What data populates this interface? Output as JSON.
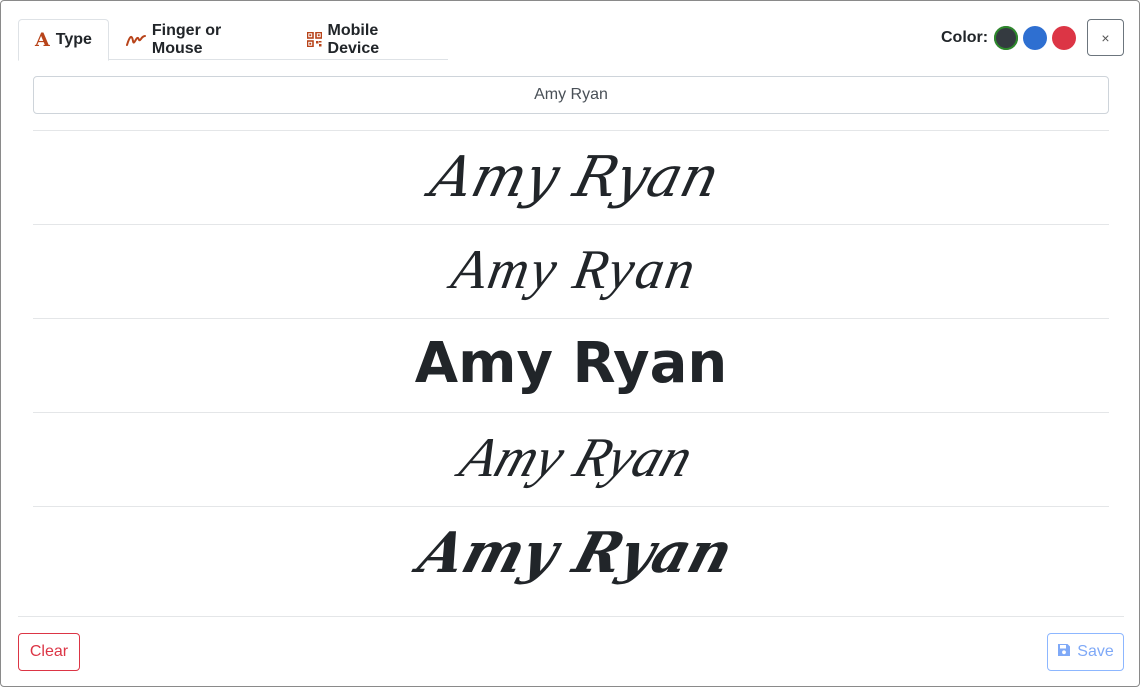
{
  "tabs": [
    {
      "label": "Type",
      "icon": "letter-a-icon",
      "active": true
    },
    {
      "label": "Finger or Mouse",
      "icon": "pen-squiggle-icon",
      "active": false
    },
    {
      "label": "Mobile Device",
      "icon": "qr-code-icon",
      "active": false
    }
  ],
  "colors": {
    "label": "Color:",
    "options": [
      "#343a40",
      "#2e6fd1",
      "#dc3545"
    ],
    "selected": "#343a40",
    "selected_ring": "#2d8a2b"
  },
  "close": {
    "label": "×"
  },
  "name_input": {
    "value": "Amy Ryan"
  },
  "signatures": [
    {
      "text": "Amy Ryan",
      "style": "script-light"
    },
    {
      "text": "Amy Ryan",
      "style": "script-handwritten"
    },
    {
      "text": "Amy Ryan",
      "style": "bold-rounded"
    },
    {
      "text": "Amy Ryan",
      "style": "script-flourish"
    },
    {
      "text": "Amy Ryan",
      "style": "brush-bold"
    }
  ],
  "footer": {
    "clear_label": "Clear",
    "save_label": "Save"
  },
  "accent": {
    "tab_icon": "#b8441a",
    "clear": "#dc3545",
    "save": "#7fa9f7"
  }
}
